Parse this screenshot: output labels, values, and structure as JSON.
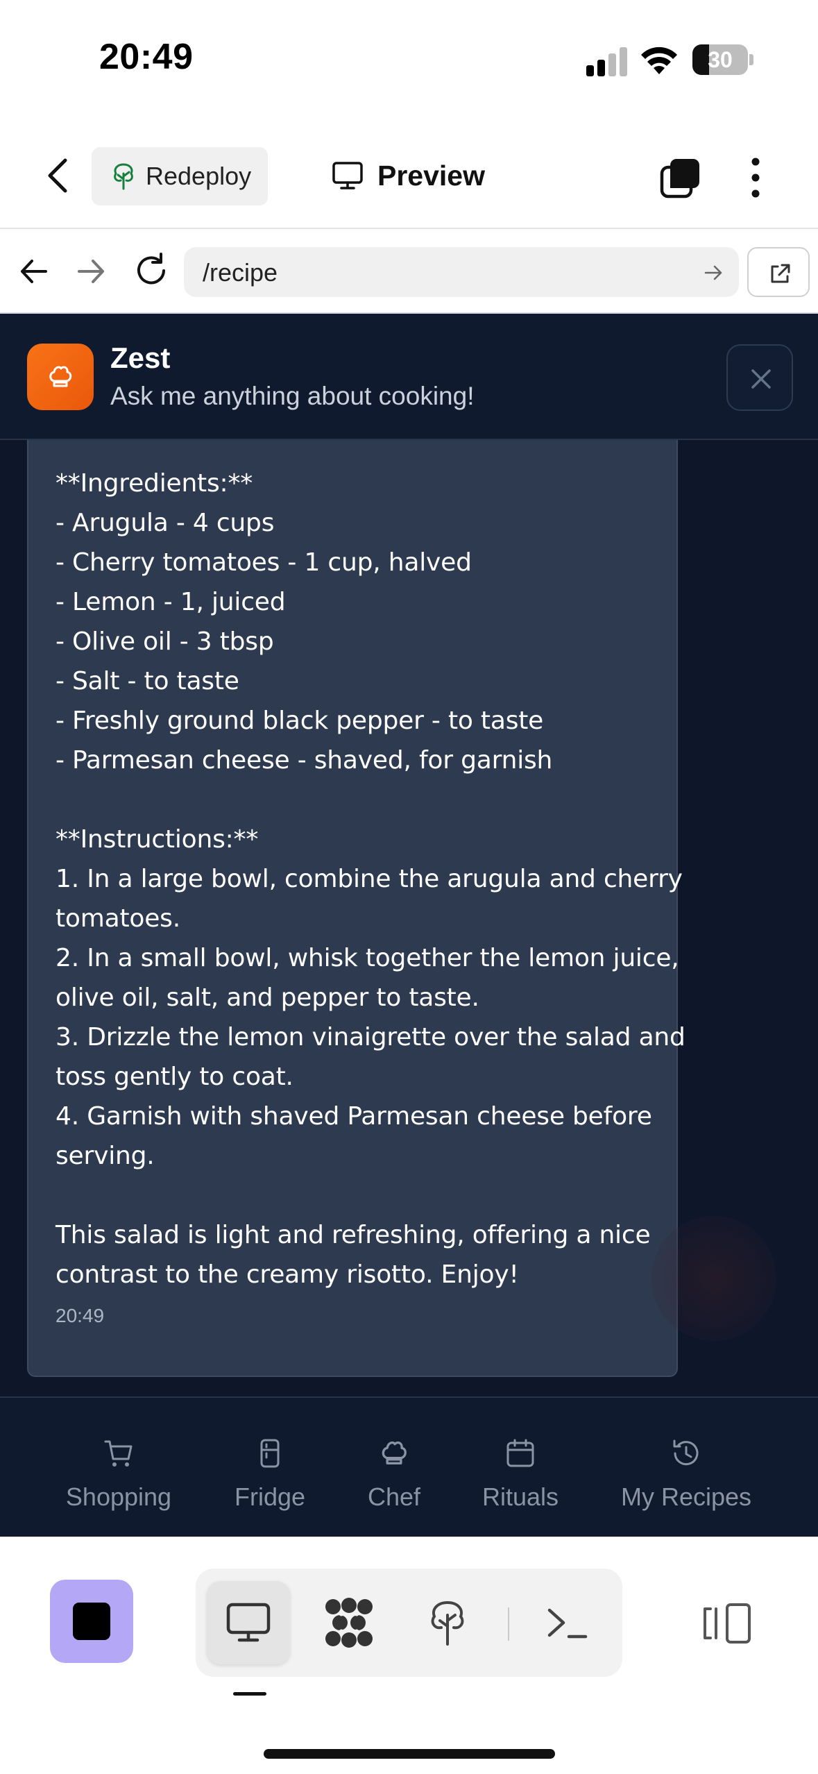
{
  "status_bar": {
    "time": "20:49",
    "battery": "30"
  },
  "header": {
    "redeploy_label": "Redeploy",
    "preview_label": "Preview"
  },
  "browser": {
    "url": "/recipe"
  },
  "chat": {
    "title": "Zest",
    "subtitle": "Ask me anything about cooking!",
    "message_lines": [
      "**Ingredients:**",
      "- Arugula - 4 cups",
      "- Cherry tomatoes - 1 cup, halved",
      "- Lemon - 1, juiced",
      "- Olive oil - 3 tbsp",
      "- Salt - to taste",
      "- Freshly ground black pepper - to taste",
      "- Parmesan cheese - shaved, for garnish",
      "",
      "**Instructions:**",
      "1. In a large bowl, combine the arugula and cherry",
      "tomatoes.",
      "2. In a small bowl, whisk together the lemon juice,",
      "olive oil, salt, and pepper to taste.",
      "3. Drizzle the lemon vinaigrette over the salad and",
      "toss gently to coat.",
      "4. Garnish with shaved Parmesan cheese before",
      "serving.",
      "",
      "This salad is light and refreshing, offering a nice",
      "contrast to the creamy risotto. Enjoy!"
    ],
    "message_time": "20:49"
  },
  "bottom_nav": {
    "items": [
      {
        "label": "Shopping",
        "icon": "cart-icon"
      },
      {
        "label": "Fridge",
        "icon": "fridge-icon"
      },
      {
        "label": "Chef",
        "icon": "chef-hat-icon"
      },
      {
        "label": "Rituals",
        "icon": "calendar-icon"
      },
      {
        "label": "My Recipes",
        "icon": "history-icon"
      }
    ]
  },
  "colors": {
    "accent_orange": "#f97316",
    "chat_bg": "#0e172a",
    "bubble_bg": "#2d3a4f",
    "stop_button": "#b4a7f5"
  }
}
